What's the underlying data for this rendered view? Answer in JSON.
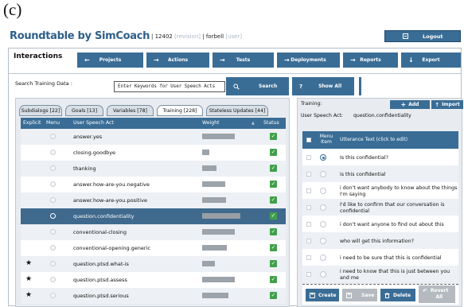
{
  "figure_label": "(c)",
  "app": {
    "name": "Roundtable by SimCoach",
    "meta_separator": "|",
    "revision_number": "12402",
    "revision_label": "[revision]",
    "user_name": "forbell",
    "user_label": "[user]",
    "logout_label": "Logout"
  },
  "nav": {
    "title": "Interactions",
    "buttons": [
      {
        "label": "Projects",
        "icon": "arrow-left-icon",
        "glyph": "←"
      },
      {
        "label": "Actions",
        "icon": "arrow-right-icon",
        "glyph": "→"
      },
      {
        "label": "Tests",
        "icon": "arrow-right-icon",
        "glyph": "→"
      },
      {
        "label": "Deployments",
        "icon": "arrow-right-icon",
        "glyph": "→"
      },
      {
        "label": "Reports",
        "icon": "arrow-right-icon",
        "glyph": "→"
      },
      {
        "label": "Export",
        "icon": "arrow-down-icon",
        "glyph": "↓"
      }
    ]
  },
  "search": {
    "label": "Search Training Data :",
    "placeholder": "Enter Keywords for User Speech Acts",
    "search_label": "Search",
    "show_all_label": "Show All"
  },
  "tabs": [
    {
      "label": "Subdialogs [22]",
      "active": false
    },
    {
      "label": "Goals [13]",
      "active": false
    },
    {
      "label": "Variables [78]",
      "active": false
    },
    {
      "label": "Training [228]",
      "active": true
    },
    {
      "label": "Stateless Updates [44]",
      "active": false
    }
  ],
  "grid": {
    "columns": [
      "Explicit",
      "Menu",
      "User Speech Act",
      "Weight",
      "Status"
    ],
    "sort_indicator": "▲",
    "rows": [
      {
        "explicit": false,
        "act": "answer.yes",
        "weight": 0.68,
        "status": true,
        "selected": false
      },
      {
        "explicit": false,
        "act": "closing.goodbye",
        "weight": 0.15,
        "status": true,
        "selected": false
      },
      {
        "explicit": false,
        "act": "thanking",
        "weight": 0.3,
        "status": true,
        "selected": false
      },
      {
        "explicit": false,
        "act": "answer.how-are-you.negative",
        "weight": 0.48,
        "status": true,
        "selected": false
      },
      {
        "explicit": false,
        "act": "answer.how-are-you.positive",
        "weight": 0.5,
        "status": true,
        "selected": false
      },
      {
        "explicit": false,
        "act": "question.confidentiality",
        "weight": 0.8,
        "status": true,
        "selected": true
      },
      {
        "explicit": false,
        "act": "conventional-closing",
        "weight": 0.68,
        "status": true,
        "selected": false
      },
      {
        "explicit": false,
        "act": "conventional-opening.generic",
        "weight": 0.52,
        "status": true,
        "selected": false
      },
      {
        "explicit": true,
        "act": "question.ptsd.what-is",
        "weight": 0.26,
        "status": true,
        "selected": false
      },
      {
        "explicit": true,
        "act": "question.ptsd.assess",
        "weight": 0.68,
        "status": true,
        "selected": false
      },
      {
        "explicit": true,
        "act": "question.ptsd.serious",
        "weight": 0.55,
        "status": true,
        "selected": false
      }
    ]
  },
  "training": {
    "label": "Training:",
    "add_label": "Add",
    "import_label": "Import",
    "act_label": "User Speech Act:",
    "act_value": "question.confidentiality",
    "columns": [
      "Menu Item",
      "Utterance Text (click to edit)"
    ],
    "utterances": [
      {
        "text": "Is this confidential?",
        "menu": true
      },
      {
        "text": "is this confidential",
        "menu": false
      },
      {
        "text": "i don't want anybody to know about the things I'm saying",
        "menu": false
      },
      {
        "text": "I'd like to confirm that our conversation is confidential",
        "menu": false
      },
      {
        "text": "i don't want anyone to find out about this",
        "menu": false
      },
      {
        "text": "who will get this information?",
        "menu": false
      },
      {
        "text": "i need to be sure that this is confidential",
        "menu": false
      },
      {
        "text": "i need to know that this is just between you and me",
        "menu": false
      }
    ],
    "actions": {
      "create": "Create",
      "save": "Save",
      "delete": "Delete",
      "revert": "Revert All"
    }
  },
  "colors": {
    "accent": "#3a6d96",
    "selected_row": "#3f6a8e",
    "status_ok": "#3fa04a"
  }
}
